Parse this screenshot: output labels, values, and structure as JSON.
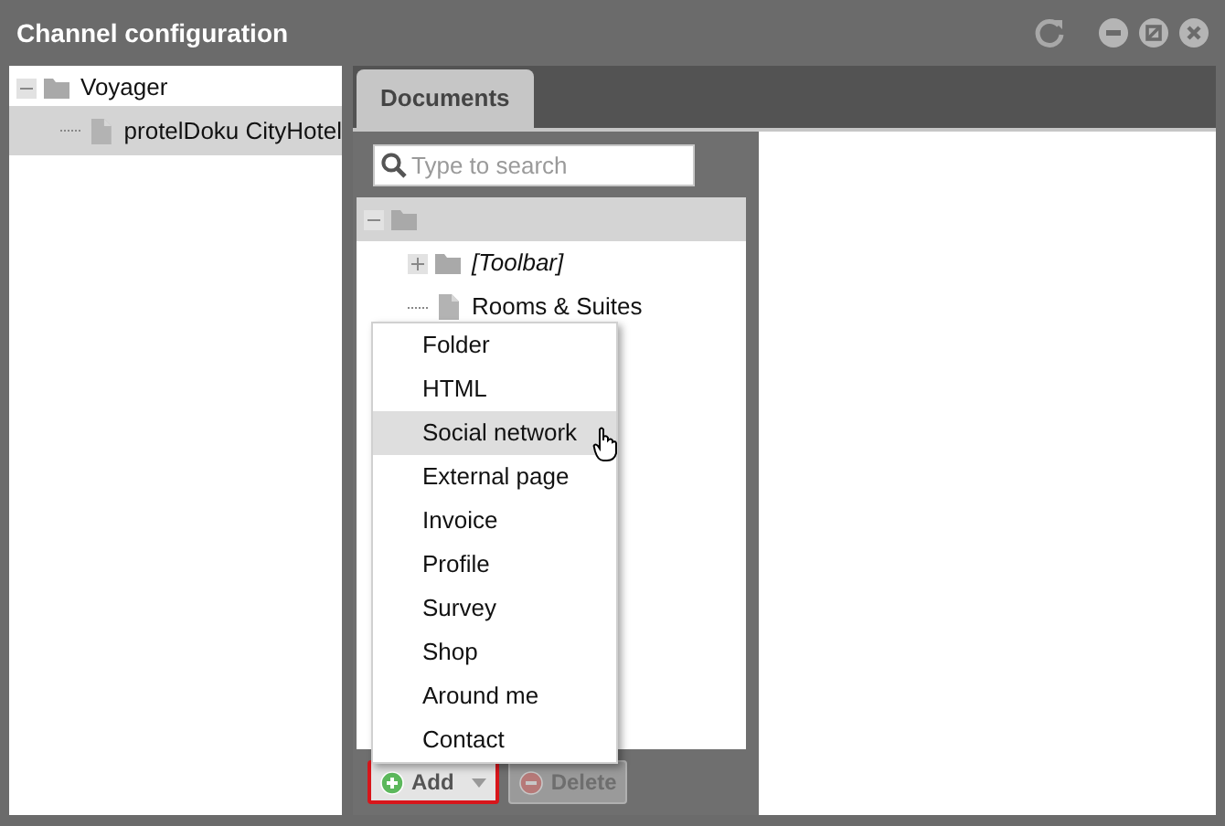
{
  "window": {
    "title": "Channel configuration"
  },
  "channel_tree": [
    {
      "label": "Voyager",
      "kind": "folder",
      "expanded": true,
      "selected": false,
      "children": [
        {
          "label": "protelDoku CityHotel",
          "kind": "document",
          "selected": true
        }
      ]
    }
  ],
  "tabs": [
    {
      "label": "Documents",
      "selected": true
    }
  ],
  "search": {
    "placeholder": "Type to search"
  },
  "document_tree": {
    "kind": "folder",
    "expanded": true,
    "selected": true,
    "children": [
      {
        "label": "[Toolbar]",
        "kind": "folder",
        "expanded": false,
        "selected": false
      },
      {
        "label": "Rooms & Suites",
        "kind": "document",
        "selected": false
      }
    ]
  },
  "add_menu": [
    {
      "label": "Folder",
      "selected": false
    },
    {
      "label": "HTML",
      "selected": false
    },
    {
      "label": "Social network",
      "selected": true
    },
    {
      "label": "External page",
      "selected": false
    },
    {
      "label": "Invoice",
      "selected": false
    },
    {
      "label": "Profile",
      "selected": false
    },
    {
      "label": "Survey",
      "selected": false
    },
    {
      "label": "Shop",
      "selected": false
    },
    {
      "label": "Around me",
      "selected": false
    },
    {
      "label": "Contact",
      "selected": false
    }
  ],
  "buttons": [
    {
      "label": "Add",
      "kind": "add",
      "disabled": false,
      "focused": true
    },
    {
      "label": "Delete",
      "kind": "delete",
      "disabled": true,
      "focused": false
    }
  ]
}
